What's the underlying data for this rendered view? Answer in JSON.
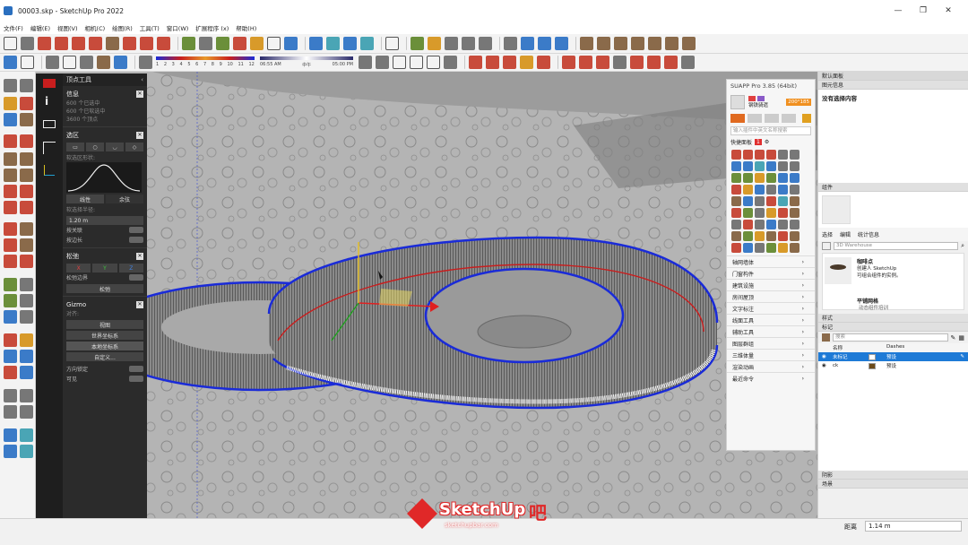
{
  "window": {
    "title": "00003.skp - SketchUp Pro 2022",
    "controls": [
      "—",
      "❐",
      "✕"
    ]
  },
  "menu": [
    "文件(F)",
    "编辑(E)",
    "视图(V)",
    "相机(C)",
    "绘图(R)",
    "工具(T)",
    "窗口(W)",
    "扩展程序 (x)",
    "帮助(H)"
  ],
  "shadow_bar": {
    "months": [
      "1",
      "2",
      "3",
      "4",
      "5",
      "6",
      "7",
      "8",
      "9",
      "10",
      "11",
      "12"
    ],
    "time_start": "06:55 AM",
    "time_mid": "中午",
    "time_end": "05:00 PM"
  },
  "vertex_tools": {
    "title": "顶点工具",
    "info": {
      "heading": "信息",
      "lines": [
        "600 个已选中",
        "600 个已软选中",
        "3600 个顶点"
      ]
    },
    "selection": {
      "heading": "选区",
      "curve_label": "软选区形状:",
      "btn_linear": "线性",
      "btn_smooth": "余弦",
      "radius_label": "软选择半径:",
      "radius_value": "1.20 m",
      "toggle_1": "按关联",
      "toggle_2": "按边长"
    },
    "relax": {
      "heading": "松弛",
      "axes": [
        "X",
        "Y",
        "Z"
      ],
      "toggle": "松弛边界",
      "btn": "松弛"
    },
    "gizmo": {
      "heading": "Gizmo",
      "align_label": "对齐:",
      "btns": [
        "视图",
        "世界坐标系",
        "本地坐标系",
        "自定义..."
      ],
      "toggle_1": "方向锁定",
      "toggle_2": "可见"
    }
  },
  "suapp": {
    "title": "SUAPP Pro 3.85 (64bit)",
    "badge": "200°185",
    "user": "钢铁骑遗",
    "search_placeholder": "输入插件中英文名称搜索",
    "quick_label": "快捷面板",
    "quick_count": "1",
    "categories": [
      "轴网墙体",
      "门窗构件",
      "建筑设施",
      "房间屋顶",
      "文字标注",
      "线面工具",
      "辅助工具",
      "图层群组",
      "三维体量",
      "渲染动画",
      "最近命令"
    ]
  },
  "tray": {
    "title": "默认面板",
    "entity_info": {
      "heading": "图元信息",
      "text": "没有选择内容"
    },
    "components": {
      "heading": "组件",
      "tabs": [
        "选择",
        "编辑",
        "统计信息"
      ],
      "search_placeholder": "3D Warehouse",
      "item1_title": "咖啡点",
      "item1_desc": "创建人 SketchUp\n可组合组件的实例。",
      "item2_title": "平铺网格",
      "footer": "动态组件培训"
    },
    "styles": {
      "heading": "样式"
    },
    "tags": {
      "heading": "标记",
      "search_placeholder": "搜索",
      "col_name": "名称",
      "col_dashes": "Dashes",
      "rows": [
        {
          "name": "未标记",
          "dash": "预设",
          "color": "#ffffff"
        },
        {
          "name": "ck",
          "dash": "预设",
          "color": "#6b4a1a"
        }
      ]
    },
    "shadows": {
      "heading": "阴影"
    },
    "scenes": {
      "heading": "场景"
    }
  },
  "status": {
    "distance_label": "距离",
    "distance_value": "1.14 m"
  },
  "watermark": {
    "brand": "SketchUp",
    "suffix": "吧",
    "url": "sketchupbar.com"
  },
  "colors": {
    "selected_row": "#1e7ad6",
    "ring_outline": "#1a2bd8",
    "ring_center_line": "#c81e1e",
    "watermark_red": "#e02828"
  }
}
